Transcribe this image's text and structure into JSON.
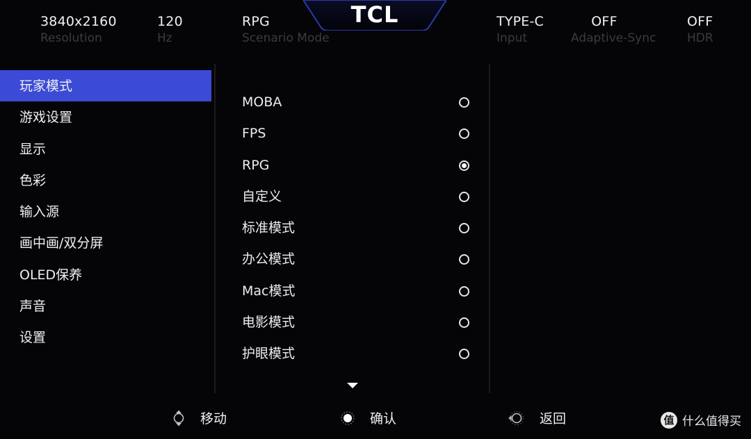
{
  "brand": {
    "logo_text": "TCL"
  },
  "status": [
    {
      "value": "3840x2160",
      "label": "Resolution"
    },
    {
      "value": "120",
      "label": "Hz"
    },
    {
      "value": "RPG",
      "label": "Scenario Mode"
    },
    {
      "value": "TYPE-C",
      "label": "Input"
    },
    {
      "value": "OFF",
      "label": "Adaptive-Sync"
    },
    {
      "value": "OFF",
      "label": "HDR"
    }
  ],
  "menu": {
    "items": [
      {
        "label": "玩家模式",
        "active": true
      },
      {
        "label": "游戏设置"
      },
      {
        "label": "显示"
      },
      {
        "label": "色彩"
      },
      {
        "label": "输入源"
      },
      {
        "label": "画中画/双分屏"
      },
      {
        "label": "OLED保养"
      },
      {
        "label": "声音"
      },
      {
        "label": "设置"
      }
    ]
  },
  "options": {
    "items": [
      {
        "label": "MOBA",
        "selected": false
      },
      {
        "label": "FPS",
        "selected": false
      },
      {
        "label": "RPG",
        "selected": true
      },
      {
        "label": "自定义",
        "selected": false
      },
      {
        "label": "标准模式",
        "selected": false
      },
      {
        "label": "办公模式",
        "selected": false
      },
      {
        "label": "Mac模式",
        "selected": false
      },
      {
        "label": "电影模式",
        "selected": false
      },
      {
        "label": "护眼模式",
        "selected": false
      }
    ]
  },
  "hints": {
    "move": "移动",
    "confirm": "确认",
    "back": "返回"
  },
  "watermark": {
    "icon_char": "值",
    "text": "什么值得买"
  },
  "colors": {
    "active_menu": "#3b4bd6",
    "background": "#050508",
    "dim_label": "#3a3a42",
    "logo_tab": "#1f2a8a"
  }
}
